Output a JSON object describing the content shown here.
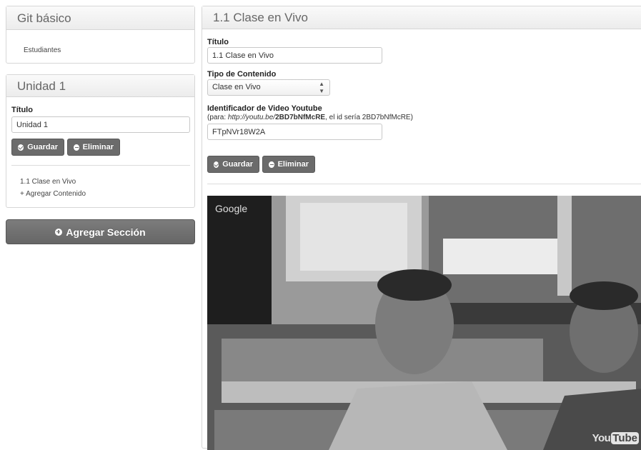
{
  "course": {
    "title": "Git básico",
    "students_link": "Estudiantes"
  },
  "unit": {
    "header": "Unidad 1",
    "title_label": "Título",
    "title_value": "Unidad 1",
    "save_label": "Guardar",
    "delete_label": "Eliminar",
    "contents": [
      "1.1 Clase en Vivo"
    ],
    "add_content_label": "+ Agregar Contenido"
  },
  "add_section_label": "Agregar Sección",
  "content": {
    "header": "1.1 Clase en Vivo",
    "title_label": "Título",
    "title_value": "1.1 Clase en Vivo",
    "type_label": "Tipo de Contenido",
    "type_value": "Clase en Vivo",
    "video_id_label": "Identificador de Video Youtube",
    "hint_prefix": "(para: ",
    "hint_url": "http://youtu.be/",
    "hint_id": "2BD7bNfMcRE",
    "hint_suffix": ", el id sería 2BD7bNfMcRE)",
    "video_id_value": "FTpNVr18W2A",
    "save_label": "Guardar",
    "delete_label": "Eliminar"
  },
  "video": {
    "watermark": "Google",
    "logo_you": "You",
    "logo_tube": "Tube"
  }
}
